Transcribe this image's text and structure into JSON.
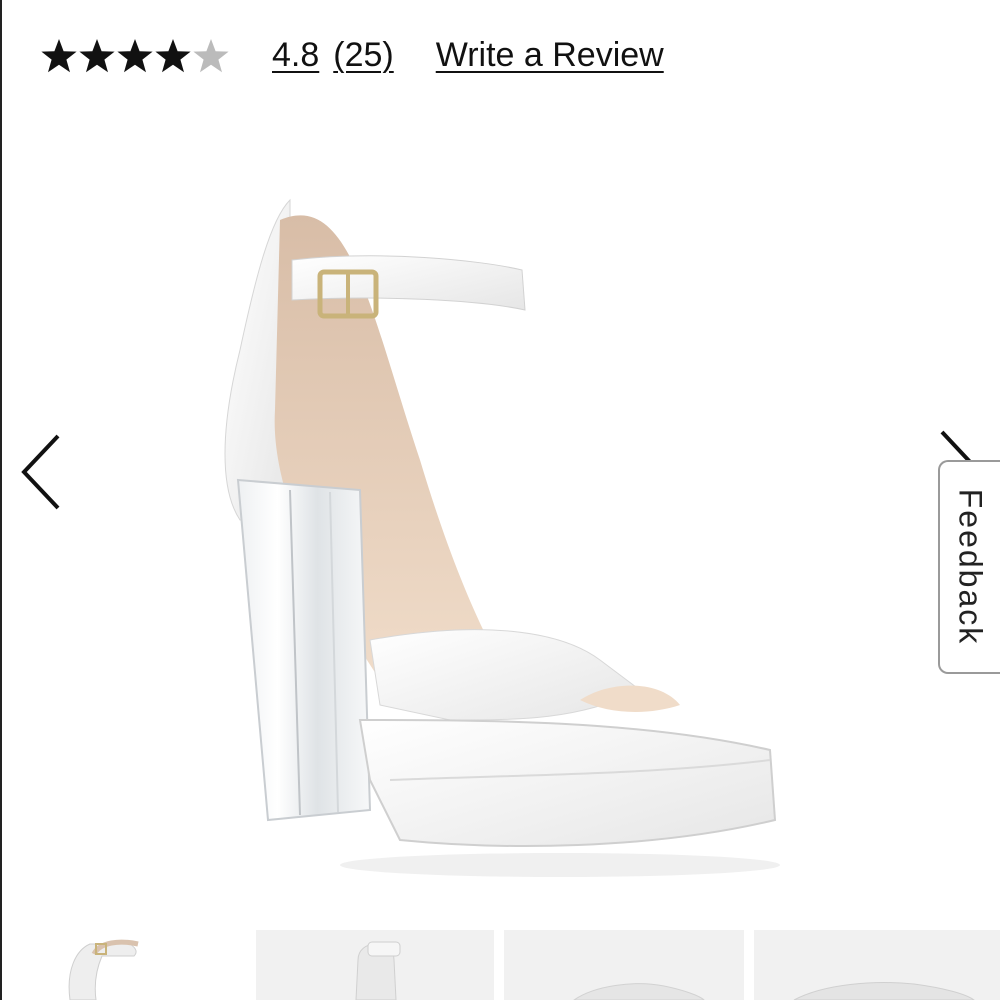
{
  "rating": {
    "stars_value": 4.8,
    "stars_max": 5,
    "average_text": "4.8",
    "count_text": "(25)",
    "write_review_label": "Write a Review"
  },
  "product": {
    "image_icon": "white-platform-sandal-image"
  },
  "carousel": {
    "prev_icon": "chevron-left-icon",
    "next_icon": "chevron-right-icon",
    "thumbnail_count": 4
  },
  "feedback": {
    "label": "Feedback"
  },
  "colors": {
    "text": "#111111",
    "thumb_bg": "#f1f1f1",
    "feedback_border": "#9a9a9a"
  }
}
